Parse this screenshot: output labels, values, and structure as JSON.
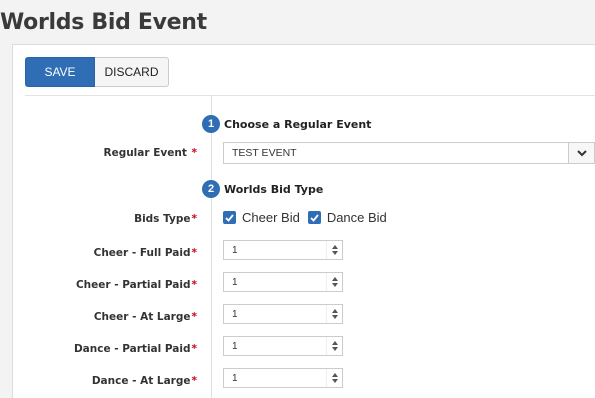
{
  "page": {
    "title": "Worlds Bid Event"
  },
  "toolbar": {
    "save_label": "SAVE",
    "discard_label": "DISCARD"
  },
  "steps": [
    {
      "number": "1",
      "title": "Choose a Regular Event"
    },
    {
      "number": "2",
      "title": "Worlds Bid Type"
    }
  ],
  "regular_event": {
    "label": "Regular Event",
    "required_mark": "*",
    "value": "TEST EVENT"
  },
  "bids_type": {
    "label": "Bids Type",
    "required_mark": "*",
    "options": [
      {
        "label": "Cheer Bid",
        "checked": true
      },
      {
        "label": "Dance Bid",
        "checked": true
      }
    ]
  },
  "fields": [
    {
      "label": "Cheer - Full Paid",
      "required_mark": "*",
      "value": "1"
    },
    {
      "label": "Cheer - Partial Paid",
      "required_mark": "*",
      "value": "1"
    },
    {
      "label": "Cheer - At Large",
      "required_mark": "*",
      "value": "1"
    },
    {
      "label": "Dance - Partial Paid",
      "required_mark": "*",
      "value": "1"
    },
    {
      "label": "Dance - At Large",
      "required_mark": "*",
      "value": "1"
    }
  ],
  "colors": {
    "primary": "#2f6db5",
    "required": "#d0021b"
  },
  "icons": {
    "select_toggle": "chevron-down-icon",
    "checkbox": "checkmark-icon",
    "spinner": "spinner-arrows-icon"
  }
}
